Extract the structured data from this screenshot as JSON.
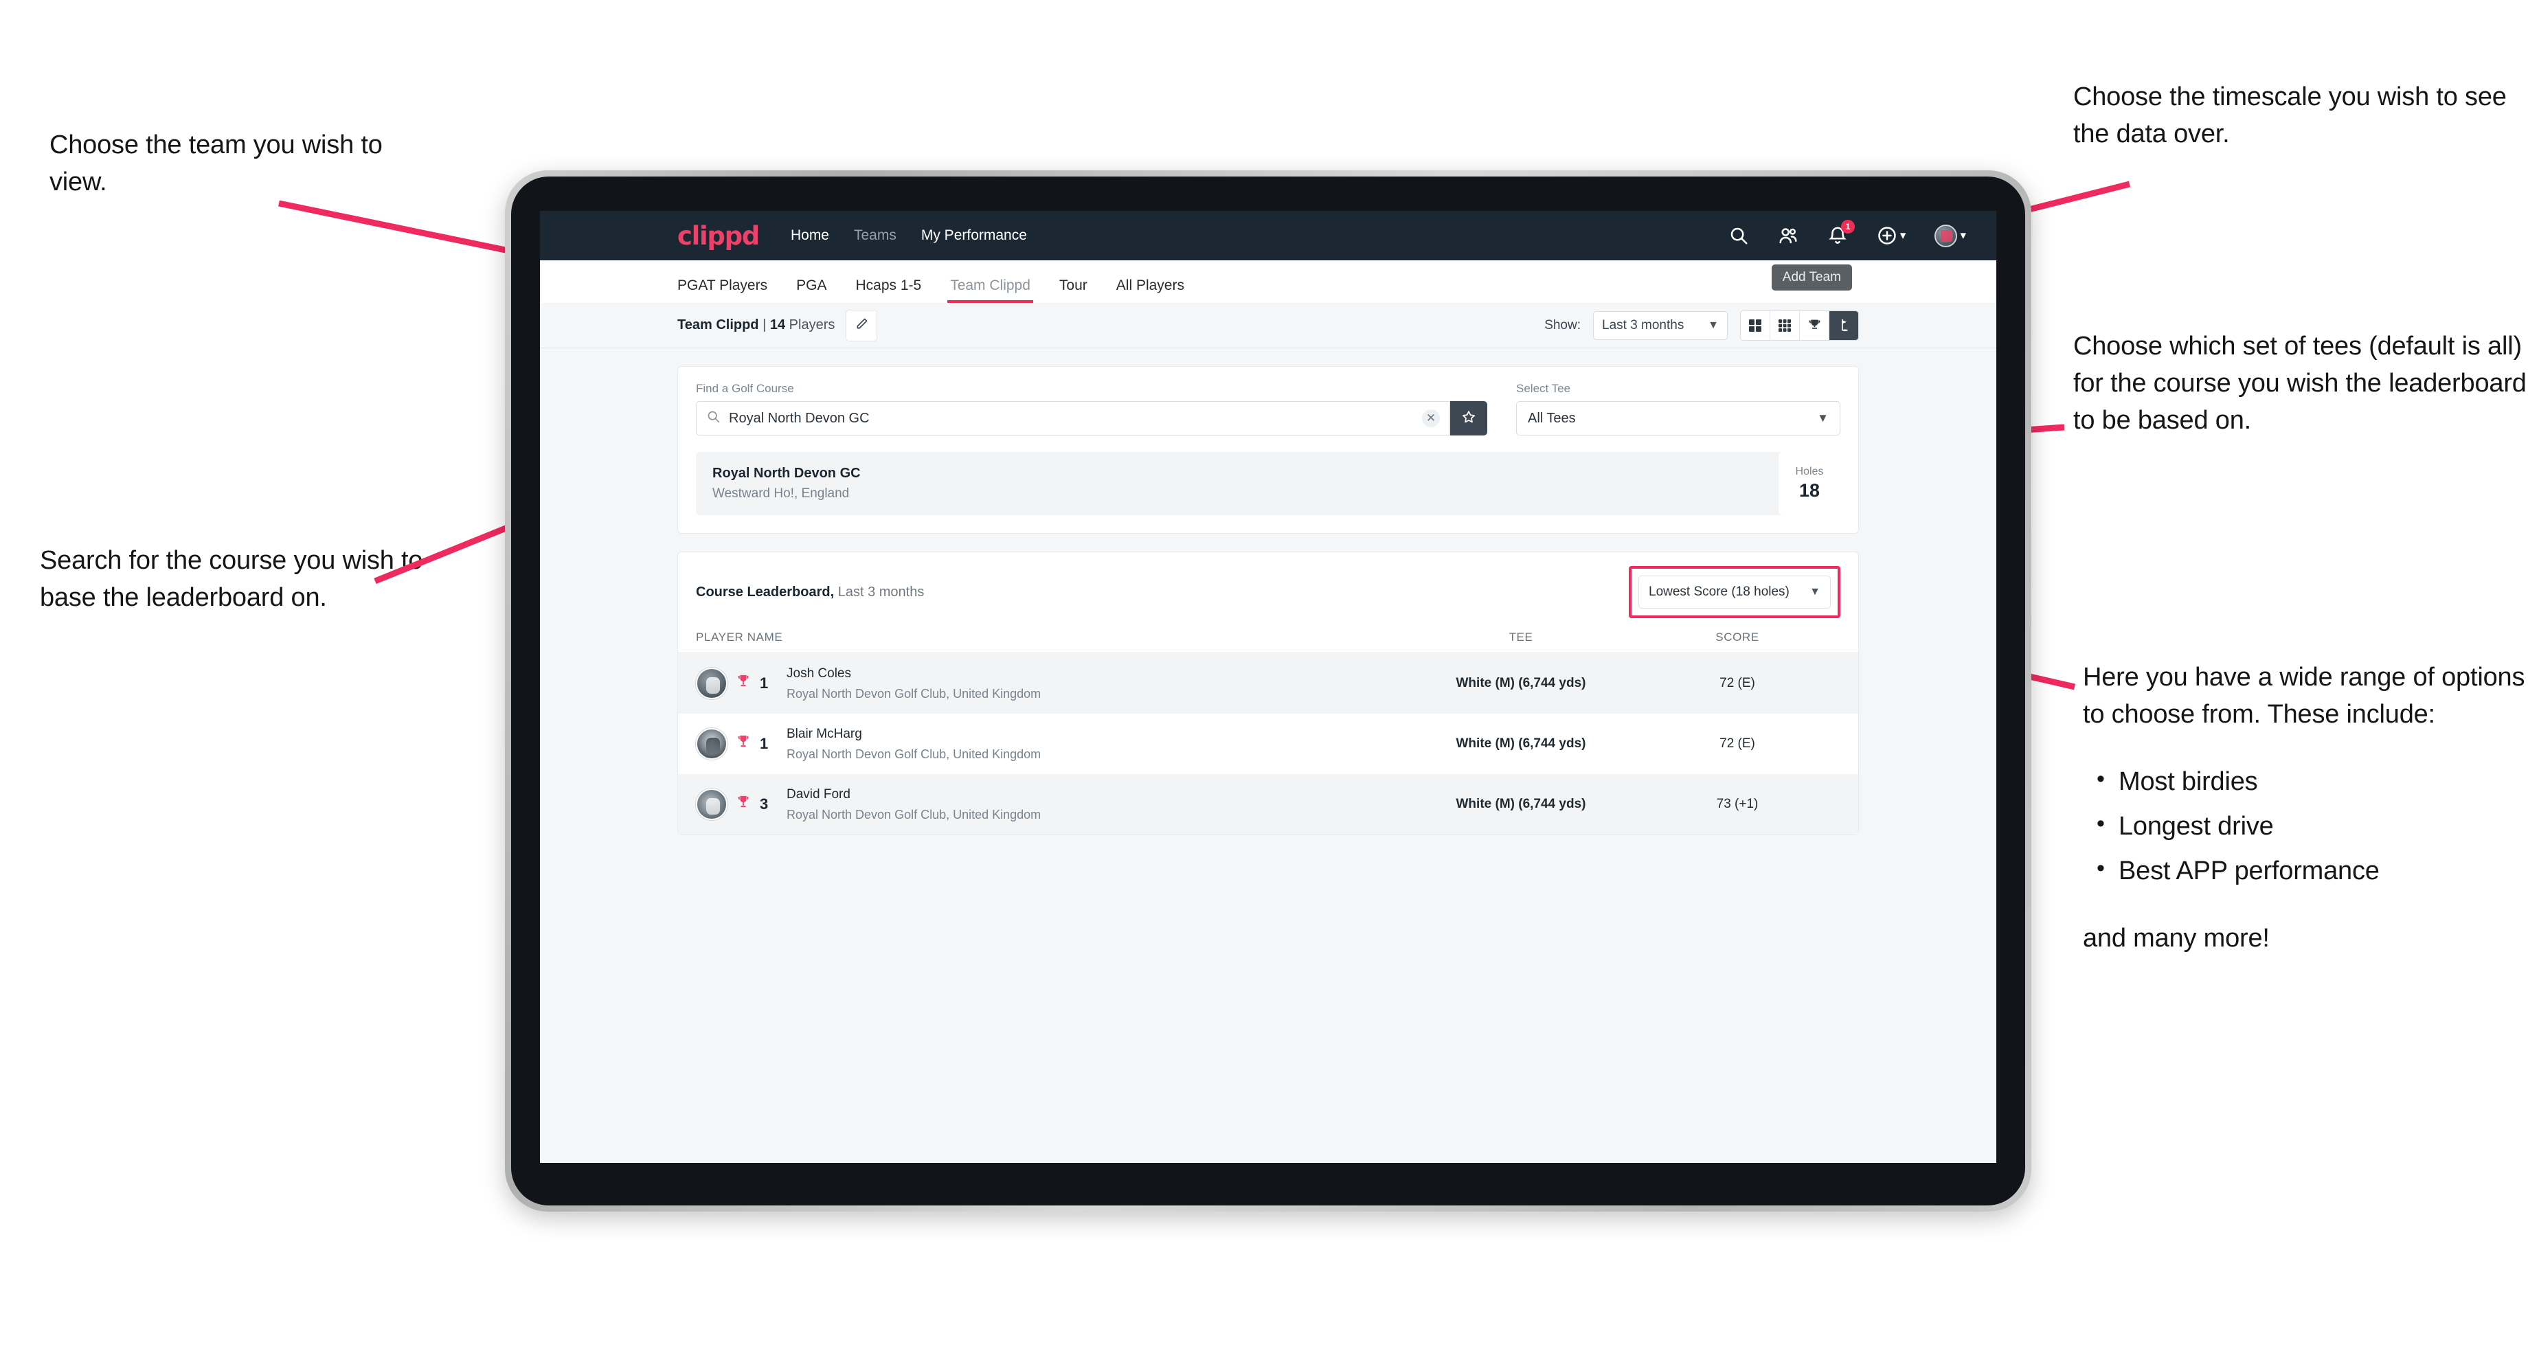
{
  "annotations": {
    "top_left": "Choose the team you wish to view.",
    "bottom_left": "Search for the course you wish to base the leaderboard on.",
    "top_right": "Choose the timescale you wish to see the data over.",
    "mid_right": "Choose which set of tees (default is all) for the course you wish the leaderboard to be based on.",
    "low_right_intro": "Here you have a wide range of options to choose from. These include:",
    "low_right_bullets": [
      "Most birdies",
      "Longest drive",
      "Best APP performance"
    ],
    "low_right_tail": "and many more!"
  },
  "colors": {
    "accent_pink": "#ef2d56",
    "navbar_dark": "#1b2733",
    "toggle_active": "#3d4852"
  },
  "navbar": {
    "logo": "clippd",
    "links": [
      {
        "label": "Home",
        "dim": false
      },
      {
        "label": "Teams",
        "dim": true
      },
      {
        "label": "My Performance",
        "dim": false
      }
    ],
    "search_icon": "search-icon",
    "people_icon": "people-icon",
    "bell_icon": "bell-icon",
    "notification_count": "1",
    "add_icon": "plus-circle-icon",
    "avatar": "user-avatar"
  },
  "tabs": {
    "items": [
      {
        "label": "PGAT Players",
        "active": false,
        "dim": false
      },
      {
        "label": "PGA",
        "active": false,
        "dim": false
      },
      {
        "label": "Hcaps 1-5",
        "active": false,
        "dim": false
      },
      {
        "label": "Team Clippd",
        "active": true,
        "dim": true
      },
      {
        "label": "Tour",
        "active": false,
        "dim": false
      },
      {
        "label": "All Players",
        "active": false,
        "dim": false
      }
    ],
    "tooltip": "Add Team"
  },
  "toolbar": {
    "team_name": "Team Clippd",
    "separator": "|",
    "player_count": "14",
    "players_word": "Players",
    "edit_icon": "pencil-icon",
    "show_label": "Show:",
    "show_value": "Last 3 months",
    "views": [
      {
        "icon": "grid-large-icon",
        "active": false
      },
      {
        "icon": "grid-small-icon",
        "active": false
      },
      {
        "icon": "trophy-icon",
        "active": false
      },
      {
        "icon": "golf-flag-icon",
        "active": true
      }
    ]
  },
  "search": {
    "course_label": "Find a Golf Course",
    "course_value": "Royal North Devon GC",
    "course_placeholder": "Find a Golf Course",
    "clear_icon": "close-icon",
    "star_icon": "star-icon",
    "tee_label": "Select Tee",
    "tee_value": "All Tees"
  },
  "course_result": {
    "name": "Royal North Devon GC",
    "location": "Westward Ho!, England",
    "holes_label": "Holes",
    "holes_value": "18"
  },
  "leaderboard": {
    "title": "Course Leaderboard,",
    "subtitle": "Last 3 months",
    "metric_value": "Lowest Score (18 holes)",
    "columns": {
      "player": "PLAYER NAME",
      "tee": "TEE",
      "score": "SCORE"
    },
    "rows": [
      {
        "rank": "1",
        "name": "Josh Coles",
        "club": "Royal North Devon Golf Club, United Kingdom",
        "tee": "White (M) (6,744 yds)",
        "score": "72 (E)"
      },
      {
        "rank": "1",
        "name": "Blair McHarg",
        "club": "Royal North Devon Golf Club, United Kingdom",
        "tee": "White (M) (6,744 yds)",
        "score": "72 (E)"
      },
      {
        "rank": "3",
        "name": "David Ford",
        "club": "Royal North Devon Golf Club, United Kingdom",
        "tee": "White (M) (6,744 yds)",
        "score": "73 (+1)"
      }
    ]
  }
}
